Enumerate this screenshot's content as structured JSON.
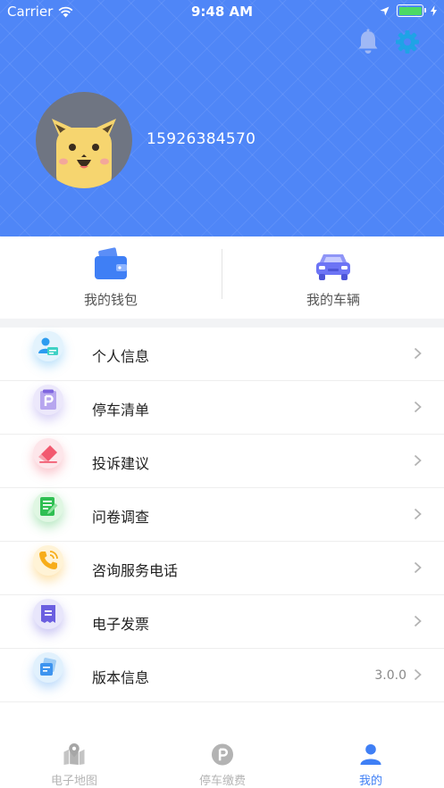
{
  "status_bar": {
    "carrier": "Carrier",
    "time": "9:48 AM"
  },
  "profile": {
    "phone": "15926384570"
  },
  "quick_actions": [
    {
      "label": "我的钱包",
      "icon": "wallet-icon"
    },
    {
      "label": "我的车辆",
      "icon": "car-icon"
    }
  ],
  "menu": [
    {
      "label": "个人信息",
      "icon": "person-card-icon",
      "value": ""
    },
    {
      "label": "停车清单",
      "icon": "parking-list-icon",
      "value": ""
    },
    {
      "label": "投诉建议",
      "icon": "eraser-icon",
      "value": ""
    },
    {
      "label": "问卷调查",
      "icon": "survey-icon",
      "value": ""
    },
    {
      "label": "咨询服务电话",
      "icon": "phone-icon",
      "value": ""
    },
    {
      "label": "电子发票",
      "icon": "invoice-icon",
      "value": ""
    },
    {
      "label": "版本信息",
      "icon": "version-icon",
      "value": "3.0.0"
    }
  ],
  "tabs": [
    {
      "label": "电子地图",
      "icon": "map-icon",
      "active": false
    },
    {
      "label": "停车缴费",
      "icon": "parking-pay-icon",
      "active": false
    },
    {
      "label": "我的",
      "icon": "user-icon",
      "active": true
    }
  ],
  "colors": {
    "brand_blue": "#4f86f7",
    "tab_active": "#3f7ff5"
  }
}
